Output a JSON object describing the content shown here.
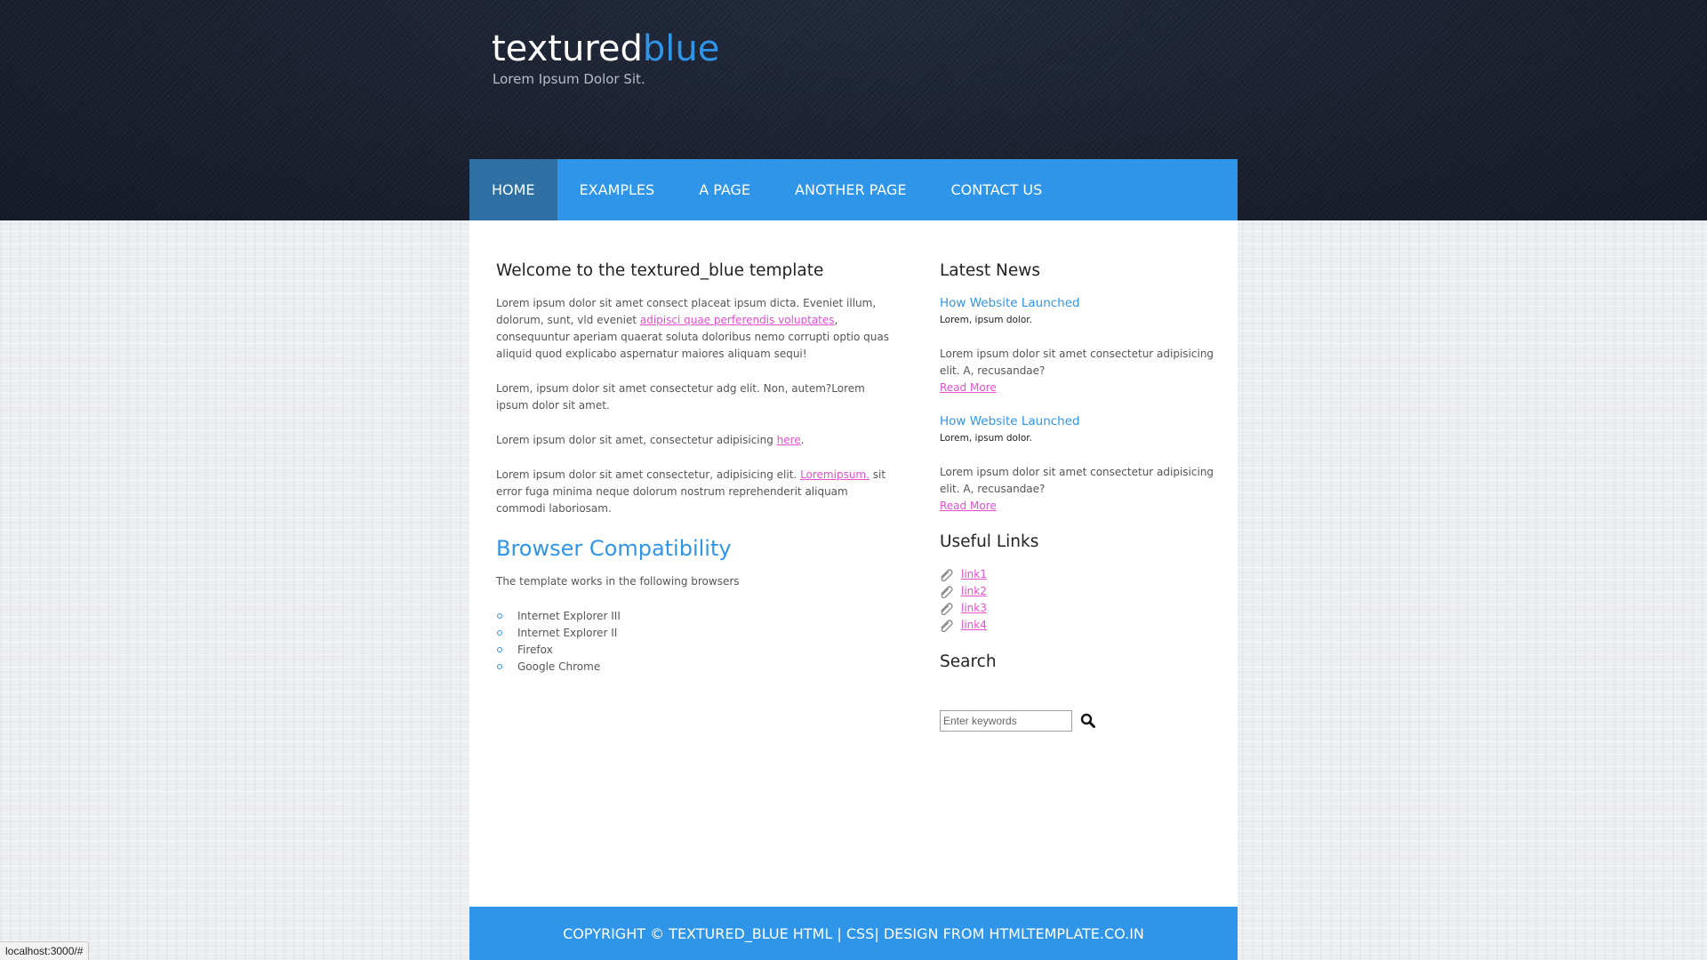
{
  "logo": {
    "title_main": "textured",
    "title_accent": "blue",
    "tagline": "Lorem Ipsum Dolor Sit."
  },
  "nav": {
    "items": [
      {
        "label": "HOME",
        "active": true
      },
      {
        "label": "EXAMPLES",
        "active": false
      },
      {
        "label": "A PAGE",
        "active": false
      },
      {
        "label": "ANOTHER PAGE",
        "active": false
      },
      {
        "label": "CONTACT US",
        "active": false
      }
    ]
  },
  "main": {
    "heading": "Welcome to the textured_blue template",
    "p1_a": "Lorem ipsum dolor sit amet consect placeat ipsum dicta. Eveniet illum, dolorum, sunt, vld eveniet ",
    "p1_link": "adipisci quae perferendis voluptates",
    "p1_b": ", consequuntur aperiam quaerat soluta doloribus nemo corrupti optio quas aliquid quod explicabo aspernatur maiores aliquam sequi!",
    "p2": "Lorem, ipsum dolor sit amet consectetur adg elit. Non, autem?Lorem ipsum dolor sit amet.",
    "p3_a": "Lorem ipsum dolor sit amet, consectetur adipisicing ",
    "p3_link": "here",
    "p3_b": ".",
    "p4_a": "Lorem ipsum dolor sit amet consectetur, adipisicing elit. ",
    "p4_link": "Loremipsum.",
    "p4_b": " sit error fuga minima neque dolorum nostrum reprehenderit aliquam commodi laboriosam.",
    "compat_heading": "Browser Compatibility",
    "compat_intro": "The template works in the following browsers",
    "browsers": [
      "Internet Explorer III",
      "Internet Explorer II",
      "Firefox",
      "Google Chrome"
    ]
  },
  "sidebar": {
    "news_heading": "Latest News",
    "news": [
      {
        "title": "How Website Launched",
        "sub": "Lorem, ipsum dolor.",
        "body": "Lorem ipsum dolor sit amet consectetur adipisicing elit. A, recusandae?",
        "more": "Read More"
      },
      {
        "title": "How Website Launched",
        "sub": "Lorem, ipsum dolor.",
        "body": "Lorem ipsum dolor sit amet consectetur adipisicing elit. A, recusandae?",
        "more": "Read More"
      }
    ],
    "links_heading": "Useful Links",
    "links": [
      "link1",
      "link2",
      "link3",
      "link4"
    ],
    "search_heading": "Search",
    "search_placeholder": "Enter keywords"
  },
  "footer": {
    "text": "COPYRIGHT © TEXTURED_BLUE HTML | CSS| DESIGN FROM HTMLTEMPLATE.CO.IN"
  },
  "status": {
    "url": "localhost:3000/#"
  },
  "colors": {
    "accent": "#2e95e8",
    "nav_active": "#2e6fa4",
    "link": "#e64fcf",
    "header_bg": "#1c2130"
  },
  "icons": {
    "link_bullet": "paperclip-icon",
    "search_button": "search-icon",
    "list_bullet": "circle-bullet-icon"
  }
}
